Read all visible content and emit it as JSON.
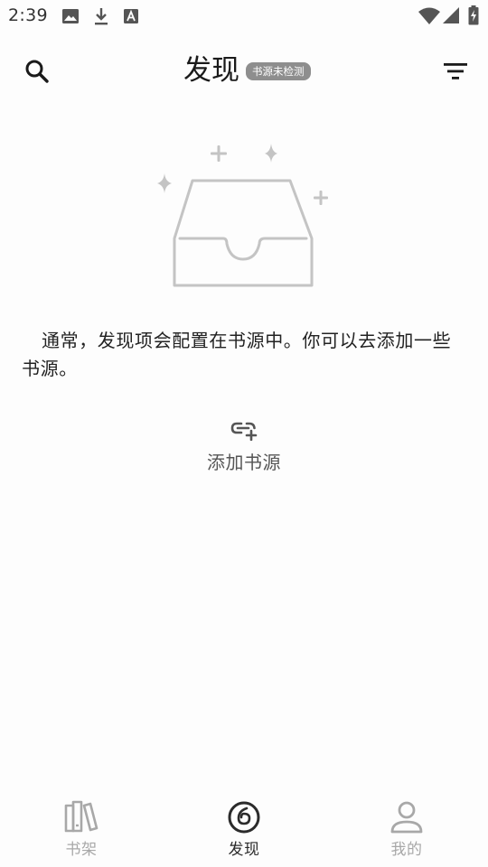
{
  "status_bar": {
    "time": "2:39",
    "left_icons": [
      "image-icon",
      "download-icon",
      "app-a-icon"
    ],
    "right_icons": [
      "wifi-icon",
      "signal-icon",
      "battery-charging-icon"
    ]
  },
  "app_bar": {
    "title": "发现",
    "badge": "书源未检测",
    "search_icon": "search-icon",
    "filter_icon": "filter-icon"
  },
  "empty_state": {
    "illustration": "empty-inbox-icon",
    "message": "通常，发现项会配置在书源中。你可以去添加一些书源。",
    "action_label": "添加书源",
    "action_icon": "add-link-icon"
  },
  "bottom_nav": {
    "items": [
      {
        "label": "书架",
        "icon": "bookshelf-icon",
        "active": false
      },
      {
        "label": "发现",
        "icon": "discover-icon",
        "active": true
      },
      {
        "label": "我的",
        "icon": "person-icon",
        "active": false
      }
    ]
  },
  "colors": {
    "background": "#fdfdfd",
    "text_primary": "#222222",
    "badge_bg": "#8e8e8e",
    "icon_inactive": "#a8a8a8",
    "icon_active": "#2b2b2b",
    "illustration": "#c4c4c4"
  }
}
